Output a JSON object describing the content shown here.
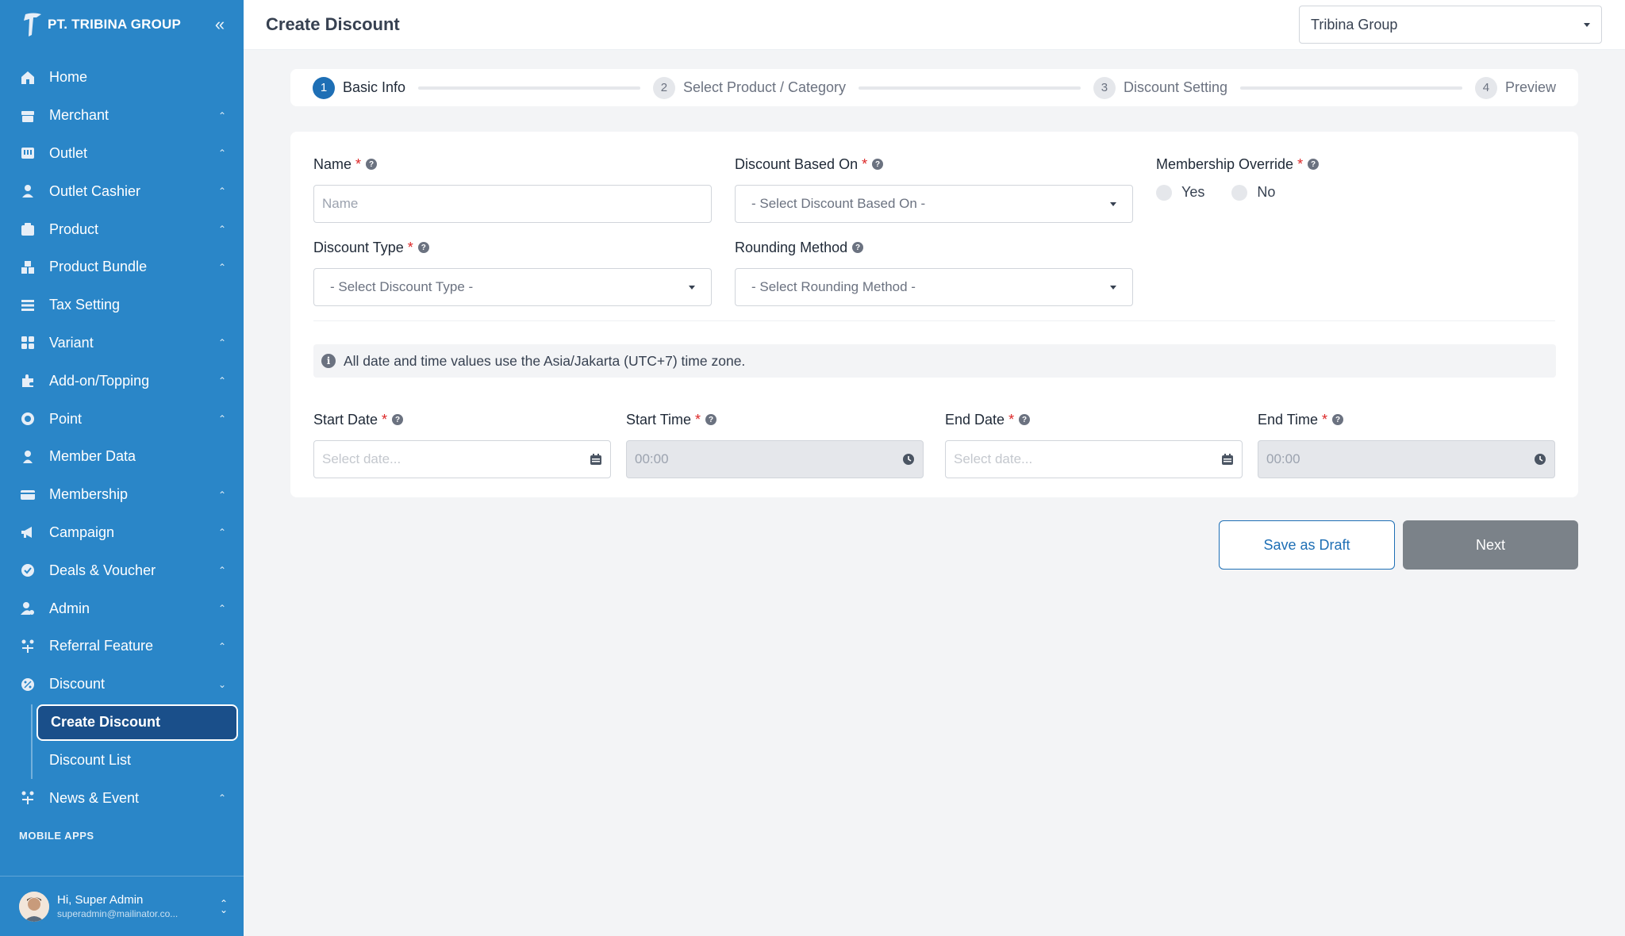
{
  "brand": {
    "name": "PT. TRIBINA GROUP"
  },
  "sidebar": {
    "items": [
      {
        "label": "Home",
        "icon": "home-icon",
        "chevron": ""
      },
      {
        "label": "Merchant",
        "icon": "store-icon",
        "chevron": "^"
      },
      {
        "label": "Outlet",
        "icon": "outlet-icon",
        "chevron": "^"
      },
      {
        "label": "Outlet Cashier",
        "icon": "user-icon",
        "chevron": "^"
      },
      {
        "label": "Product",
        "icon": "product-icon",
        "chevron": "^"
      },
      {
        "label": "Product Bundle",
        "icon": "bundle-icon",
        "chevron": "^"
      },
      {
        "label": "Tax Setting",
        "icon": "tax-icon",
        "chevron": ""
      },
      {
        "label": "Variant",
        "icon": "grid-icon",
        "chevron": "^"
      },
      {
        "label": "Add-on/Topping",
        "icon": "puzzle-icon",
        "chevron": "^"
      },
      {
        "label": "Point",
        "icon": "point-icon",
        "chevron": "^"
      },
      {
        "label": "Member Data",
        "icon": "member-icon",
        "chevron": ""
      },
      {
        "label": "Membership",
        "icon": "card-icon",
        "chevron": "^"
      },
      {
        "label": "Campaign",
        "icon": "megaphone-icon",
        "chevron": "^"
      },
      {
        "label": "Deals & Voucher",
        "icon": "badge-icon",
        "chevron": "^"
      },
      {
        "label": "Admin",
        "icon": "admin-icon",
        "chevron": "^"
      },
      {
        "label": "Referral Feature",
        "icon": "referral-icon",
        "chevron": "^"
      },
      {
        "label": "Discount",
        "icon": "discount-icon",
        "chevron": "v"
      }
    ],
    "discount_sub": [
      {
        "label": "Create Discount"
      },
      {
        "label": "Discount List"
      }
    ],
    "after": {
      "label": "News & Event",
      "icon": "news-icon",
      "chevron": "^"
    },
    "section_label": "MOBILE APPS"
  },
  "profile": {
    "greeting": "Hi, Super Admin",
    "email": "superadmin@mailinator.co..."
  },
  "header": {
    "title": "Create Discount",
    "company": "Tribina Group"
  },
  "stepper": [
    {
      "num": "1",
      "label": "Basic Info",
      "active": true
    },
    {
      "num": "2",
      "label": "Select Product / Category",
      "active": false
    },
    {
      "num": "3",
      "label": "Discount Setting",
      "active": false
    },
    {
      "num": "4",
      "label": "Preview",
      "active": false
    }
  ],
  "form": {
    "name": {
      "label": "Name",
      "placeholder": "Name"
    },
    "based_on": {
      "label": "Discount Based On",
      "value": "- Select Discount Based On -"
    },
    "membership": {
      "label": "Membership Override",
      "yes": "Yes",
      "no": "No"
    },
    "type": {
      "label": "Discount Type",
      "value": "- Select Discount Type -"
    },
    "rounding": {
      "label": "Rounding Method",
      "value": "- Select Rounding Method -"
    },
    "notice": "All date and time values use the Asia/Jakarta (UTC+7) time zone.",
    "start_date": {
      "label": "Start Date",
      "placeholder": "Select date..."
    },
    "start_time": {
      "label": "Start Time",
      "value": "00:00"
    },
    "end_date": {
      "label": "End Date",
      "placeholder": "Select date..."
    },
    "end_time": {
      "label": "End Time",
      "value": "00:00"
    }
  },
  "actions": {
    "draft": "Save as Draft",
    "next": "Next"
  }
}
